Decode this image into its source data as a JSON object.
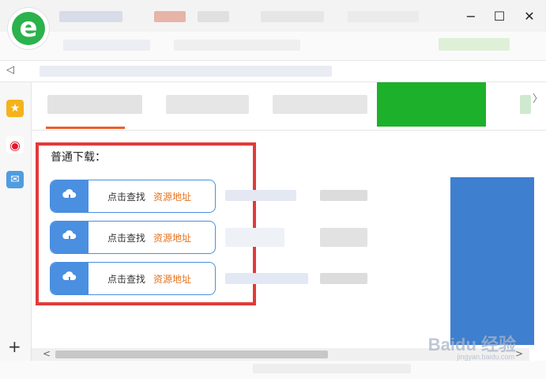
{
  "window": {
    "controls": {
      "minimize": "−",
      "maximize": "☐",
      "close": "✕"
    },
    "logo_letter": "e"
  },
  "addressbar": {
    "back_glyph": "◁"
  },
  "sidebar": {
    "icons": [
      {
        "name": "favorites-star-icon",
        "color": "#f5b21c",
        "glyph": "★"
      },
      {
        "name": "weibo-icon",
        "color": "#e6162d",
        "glyph": "◉"
      },
      {
        "name": "mail-icon",
        "color": "#4f9de0",
        "glyph": "✉"
      }
    ],
    "add_glyph": "+"
  },
  "tabstrip": {
    "accent": "#e8602c",
    "green": "#1db02a",
    "more_glyph": "〉"
  },
  "content": {
    "section_title": "普通下载：",
    "highlight_color": "#e23a3a",
    "buttons": [
      {
        "action": "点击查找",
        "link": "资源地址"
      },
      {
        "action": "点击查找",
        "link": "资源地址"
      },
      {
        "action": "点击查找",
        "link": "资源地址"
      }
    ]
  },
  "scrollbar": {
    "left_glyph": "<",
    "right_glyph": ">"
  },
  "watermark": {
    "brand": "Baidu 经验",
    "url": "jingyan.baidu.com"
  }
}
